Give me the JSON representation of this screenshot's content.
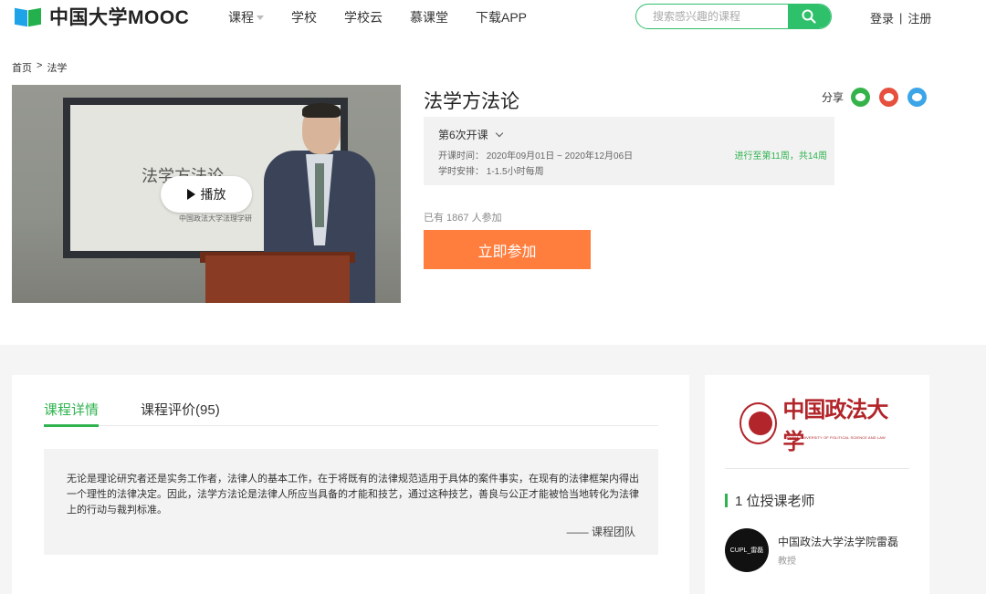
{
  "header": {
    "logo_text": "中国大学MOOC",
    "nav": [
      "课程",
      "学校",
      "学校云",
      "慕课堂",
      "下载APP"
    ],
    "search_placeholder": "搜索感兴趣的课程",
    "login_label": "登录",
    "separator": "|",
    "register_label": "注册"
  },
  "breadcrumb": {
    "home": "首页",
    "sep": ">",
    "current": "法学"
  },
  "video": {
    "screen_title": "法学方法论",
    "screen_sub": "中国政法大学法理学研",
    "play_label": "播放"
  },
  "course": {
    "title": "法学方法论",
    "share_label": "分享",
    "term_label": "第6次开课",
    "dates": "开课时间： 2020年09月01日 ~ 2020年12月06日",
    "hours": "学时安排： 1-1.5小时每周",
    "progress": "进行至第11周，共14周",
    "enrolled": "已有 1867 人参加",
    "join_label": "立即参加"
  },
  "detail": {
    "tabs": [
      "课程详情",
      "课程评价(95)"
    ],
    "description": "无论是理论研究者还是实务工作者，法律人的基本工作，在于将既有的法律规范适用于具体的案件事实，在现有的法律框架内得出一个理性的法律决定。因此，法学方法论是法律人所应当具备的才能和技艺，通过这种技艺，善良与公正才能被恰当地转化为法律上的行动与裁判标准。",
    "signature": "—— 课程团队"
  },
  "sidebar": {
    "university_cn": "中国政法大学",
    "university_en": "CHINA UNIVERSITY OF POLITICAL SCIENCE AND LAW",
    "teacher_count_label": "1 位授课老师",
    "teacher": {
      "avatar_text": "CUPL_雷磊",
      "name": "中国政法大学法学院雷磊",
      "title": "教授"
    }
  },
  "colors": {
    "brand_green": "#2fb34f",
    "join_orange": "#ff7d3d",
    "university_red": "#b2252a"
  }
}
